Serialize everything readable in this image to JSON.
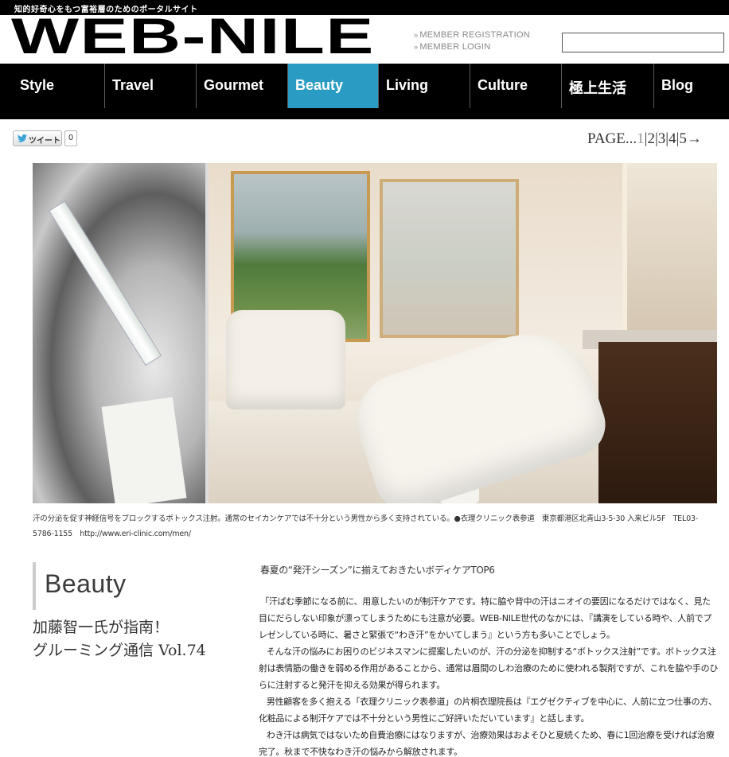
{
  "header": {
    "tagline": "知的好奇心をもつ富裕層のためのポータルサイト",
    "logo": "WEB-NILE",
    "member_registration": "MEMBER REGISTRATION",
    "member_login": "MEMBER LOGIN",
    "search_value": ""
  },
  "nav": {
    "items": [
      "Style",
      "Travel",
      "Gourmet",
      "Beauty",
      "Living",
      "Culture",
      "極上生活",
      "Blog"
    ],
    "active": "Beauty",
    "active_color": "#2a9cc3"
  },
  "share": {
    "tweet_label": "ツイート",
    "tweet_count": "0"
  },
  "pager": {
    "prefix": "PAGE...",
    "pages": [
      "1",
      "2",
      "3",
      "4",
      "5"
    ],
    "current": "1",
    "next": "→"
  },
  "hero": {
    "caption": "汗の分泌を促す神経信号をブロックするボトックス注射。通常のセイカンケアでは不十分という男性から多く支持されている。●衣理クリニック表参道　東京都港区北青山3-5-30 入来ビル5F　TEL03-5786-1155　http://www.eri-clinic.com/men/"
  },
  "article": {
    "section": "Beauty",
    "title_line1": "加藤智一氏が指南！",
    "title_line2": "グルーミング通信 Vol.74",
    "lead": "春夏の“発汗シーズン”に揃えておきたいボディケアTOP6",
    "paragraphs": [
      "「汗ばむ季節になる前に、用意したいのが制汗ケアです。特に脇や背中の汗はニオイの要因になるだけではなく、見た目にだらしない印象が漂ってしまうためにも注意が必要。WEB-NILE世代のなかには、『講演をしている時や、人前でプレゼンしている時に、暑さと緊張で“わき汗”をかいてしまう』という方も多いことでしょう。",
      "そんな汗の悩みにお困りのビジネスマンに提案したいのが、汗の分泌を抑制する“ボトックス注射”です。ボトックス注射は表情筋の働きを弱める作用があることから、通常は眉間のしわ治療のために使われる製剤ですが、これを脇や手のひらに注射すると発汗を抑える効果が得られます。",
      "男性顧客を多く抱える「衣理クリニック表参道」の片桐衣理院長は『エグゼクティブを中心に、人前に立つ仕事の方、化粧品による制汗ケアでは不十分という男性にご好評いただいています』と話します。",
      "わき汗は病気ではないため自費治療にはなりますが、治療効果はおよそひと夏続くため、春に1回治療を受ければ治療完了。秋まで不快なわき汗の悩みから解放されます。"
    ]
  }
}
